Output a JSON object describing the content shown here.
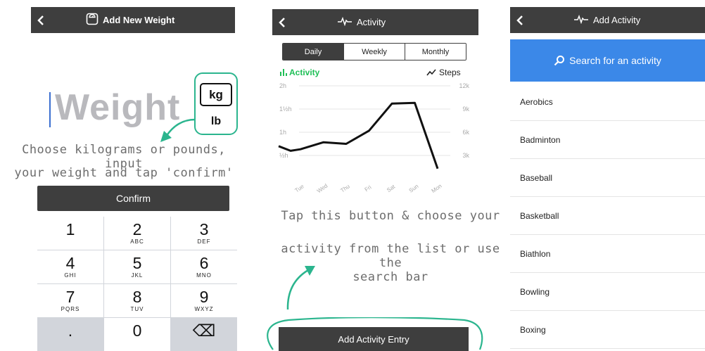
{
  "weight_screen": {
    "title": "Add New Weight",
    "placeholder_word": "Weight",
    "unit_kg": "kg",
    "unit_lb": "lb",
    "annotation_line1": "Choose kilograms or pounds, input",
    "annotation_line2": "your weight and tap 'confirm'",
    "confirm_label": "Confirm",
    "keypad": [
      {
        "num": "1",
        "sub": ""
      },
      {
        "num": "2",
        "sub": "ABC"
      },
      {
        "num": "3",
        "sub": "DEF"
      },
      {
        "num": "4",
        "sub": "GHI"
      },
      {
        "num": "5",
        "sub": "JKL"
      },
      {
        "num": "6",
        "sub": "MNO"
      },
      {
        "num": "7",
        "sub": "PQRS"
      },
      {
        "num": "8",
        "sub": "TUV"
      },
      {
        "num": "9",
        "sub": "WXYZ"
      },
      {
        "num": ".",
        "sub": ""
      },
      {
        "num": "0",
        "sub": ""
      },
      {
        "num": "⌫",
        "sub": ""
      }
    ]
  },
  "activity_screen": {
    "title": "Activity",
    "tabs": [
      "Daily",
      "Weekly",
      "Monthly"
    ],
    "active_tab": "Daily",
    "legend_left": "Activity",
    "legend_right": "Steps",
    "annotation_line1": "Tap this button & choose your",
    "annotation_line2": "activity from the list or use the",
    "annotation_line3": "search bar",
    "add_entry_label": "Add Activity Entry"
  },
  "chart_data": {
    "type": "line",
    "title": "",
    "categories": [
      "Tue",
      "Wed",
      "Thu",
      "Fri",
      "Sat",
      "Sun",
      "Mon"
    ],
    "series": [
      {
        "name": "Activity",
        "values": [
          null,
          null,
          null,
          null,
          null,
          null,
          null
        ]
      },
      {
        "name": "Steps",
        "values": [
          3800,
          4700,
          4500,
          6200,
          9700,
          9800,
          1300
        ]
      }
    ],
    "series_start_value": 4200,
    "series_points_extra": [
      3600
    ],
    "left_axis": {
      "ticks": [
        "2h",
        "1½h",
        "1h",
        "½h"
      ],
      "values_h": [
        2,
        1.5,
        1,
        0.5
      ]
    },
    "right_axis": {
      "ticks": [
        "12k",
        "9k",
        "6k",
        "3k"
      ],
      "values": [
        12000,
        9000,
        6000,
        3000
      ],
      "ylim": [
        0,
        12000
      ]
    },
    "grid": true,
    "line_color": "#111111"
  },
  "add_activity_screen": {
    "title": "Add Activity",
    "search_placeholder": "Search for an activity",
    "items": [
      "Aerobics",
      "Badminton",
      "Baseball",
      "Basketball",
      "Biathlon",
      "Bowling",
      "Boxing"
    ]
  },
  "colors": {
    "header": "#3e3e3e",
    "accent_green": "#2bb58e",
    "activity_green": "#1fbf57",
    "search_blue": "#3b88e8"
  }
}
